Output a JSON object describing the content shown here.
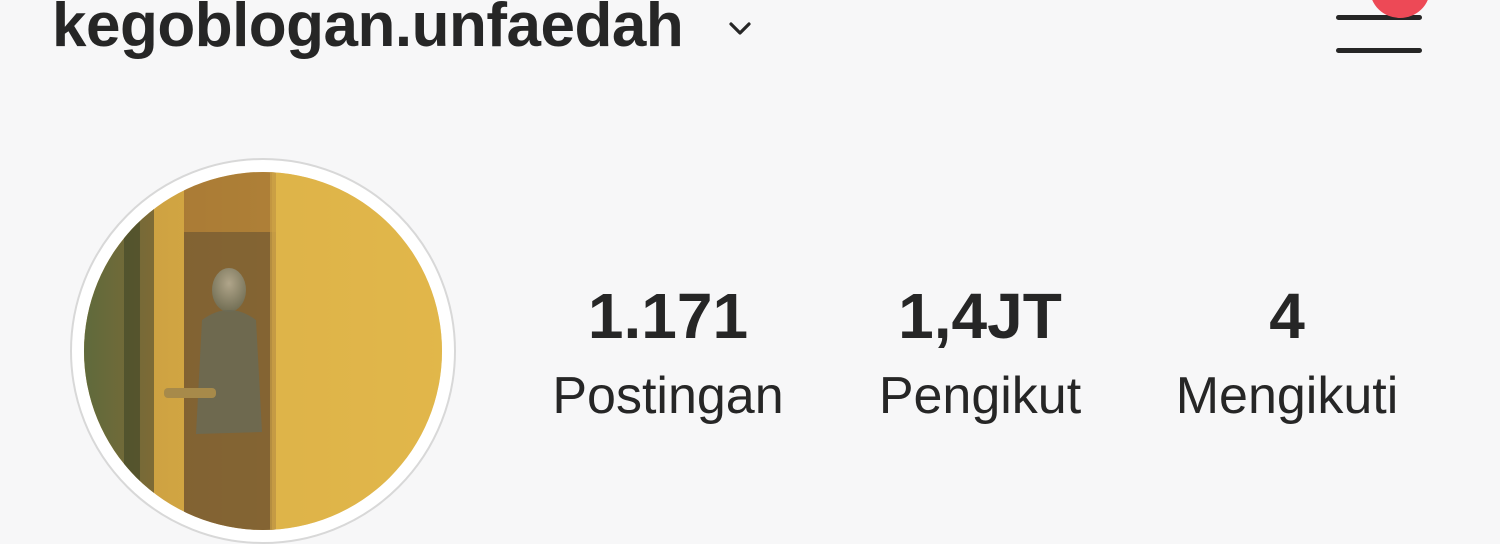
{
  "header": {
    "username": "kegoblogan.unfaedah",
    "account_switch_icon": "chevron-down-icon",
    "menu_icon": "hamburger-menu-icon",
    "has_notification": true
  },
  "profile": {
    "stats": [
      {
        "count": "1.171",
        "label": "Postingan"
      },
      {
        "count": "1,4JT",
        "label": "Pengikut"
      },
      {
        "count": "4",
        "label": "Mengikuti"
      }
    ]
  },
  "colors": {
    "text": "#262626",
    "background": "#f7f7f8",
    "notification_badge": "#ed4956",
    "avatar_ring": "#d8d8d8"
  }
}
